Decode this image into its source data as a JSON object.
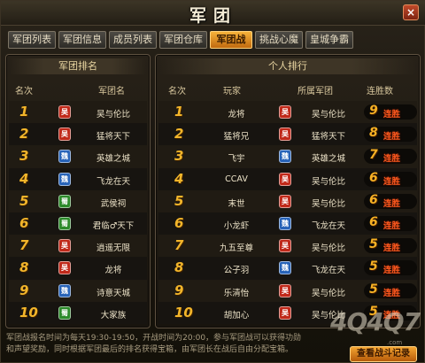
{
  "window": {
    "title": "军团",
    "close_label": "×"
  },
  "tabs": [
    {
      "label": "军团列表",
      "active": false
    },
    {
      "label": "军团信息",
      "active": false
    },
    {
      "label": "成员列表",
      "active": false
    },
    {
      "label": "军团仓库",
      "active": false
    },
    {
      "label": "军团战",
      "active": true
    },
    {
      "label": "挑战心魔",
      "active": false
    },
    {
      "label": "皇城争霸",
      "active": false
    }
  ],
  "colors": {
    "accent": "#f2b52a",
    "streak_text": "#ff5a1f",
    "badge_red": "#c0291a",
    "badge_blue": "#2763b8",
    "badge_green": "#2c8a2a"
  },
  "legion_ranking": {
    "title": "军团排名",
    "headers": {
      "rank": "名次",
      "legion": "军团名"
    },
    "rows": [
      {
        "rank": "1",
        "badge_text": "吴",
        "badge_color": "#c0291a",
        "name": "吴与伦比"
      },
      {
        "rank": "2",
        "badge_text": "吴",
        "badge_color": "#c0291a",
        "name": "猛将天下"
      },
      {
        "rank": "3",
        "badge_text": "魏",
        "badge_color": "#2763b8",
        "name": "英雄之城"
      },
      {
        "rank": "4",
        "badge_text": "魏",
        "badge_color": "#2763b8",
        "name": "飞龙在天"
      },
      {
        "rank": "5",
        "badge_text": "蜀",
        "badge_color": "#2c8a2a",
        "name": "武侯祠"
      },
      {
        "rank": "6",
        "badge_text": "蜀",
        "badge_color": "#2c8a2a",
        "name": "君临♂天下"
      },
      {
        "rank": "7",
        "badge_text": "吴",
        "badge_color": "#c0291a",
        "name": "逍遥无限"
      },
      {
        "rank": "8",
        "badge_text": "吴",
        "badge_color": "#c0291a",
        "name": "龙将"
      },
      {
        "rank": "9",
        "badge_text": "魏",
        "badge_color": "#2763b8",
        "name": "诗意天城"
      },
      {
        "rank": "10",
        "badge_text": "蜀",
        "badge_color": "#2c8a2a",
        "name": "大家族"
      }
    ]
  },
  "player_ranking": {
    "title": "个人排行",
    "headers": {
      "rank": "名次",
      "player": "玩家",
      "legion": "所属军团",
      "streak": "连胜数"
    },
    "streak_label": "连胜",
    "rows": [
      {
        "rank": "1",
        "player": "龙将",
        "badge_text": "吴",
        "badge_color": "#c0291a",
        "legion": "吴与伦比",
        "streak": "9"
      },
      {
        "rank": "2",
        "player": "猛将兄",
        "badge_text": "吴",
        "badge_color": "#c0291a",
        "legion": "猛将天下",
        "streak": "8"
      },
      {
        "rank": "3",
        "player": "飞宇",
        "badge_text": "魏",
        "badge_color": "#2763b8",
        "legion": "英雄之城",
        "streak": "7"
      },
      {
        "rank": "4",
        "player": "CCAV",
        "badge_text": "吴",
        "badge_color": "#c0291a",
        "legion": "吴与伦比",
        "streak": "6"
      },
      {
        "rank": "5",
        "player": "末世",
        "badge_text": "吴",
        "badge_color": "#c0291a",
        "legion": "吴与伦比",
        "streak": "6"
      },
      {
        "rank": "6",
        "player": "小龙虾",
        "badge_text": "魏",
        "badge_color": "#2763b8",
        "legion": "飞龙在天",
        "streak": "6"
      },
      {
        "rank": "7",
        "player": "九五至尊",
        "badge_text": "吴",
        "badge_color": "#c0291a",
        "legion": "吴与伦比",
        "streak": "5"
      },
      {
        "rank": "8",
        "player": "公子羽",
        "badge_text": "魏",
        "badge_color": "#2763b8",
        "legion": "飞龙在天",
        "streak": "5"
      },
      {
        "rank": "9",
        "player": "乐清怡",
        "badge_text": "吴",
        "badge_color": "#c0291a",
        "legion": "吴与伦比",
        "streak": "5"
      },
      {
        "rank": "10",
        "player": "胡加心",
        "badge_text": "吴",
        "badge_color": "#c0291a",
        "legion": "吴与伦比",
        "streak": "5"
      }
    ]
  },
  "footer": {
    "line1": "军团战报名时间为每天19:30-19:50，开战时间为20:00，参与军团战可以获得功勋",
    "line2": "和声望奖励，同时根据军团最后的排名获得宝箱，由军团长在战后自由分配宝箱。",
    "record_button": "查看战斗记录",
    "watermark": "4Q4Q7",
    "watermark_sub": ".com"
  }
}
